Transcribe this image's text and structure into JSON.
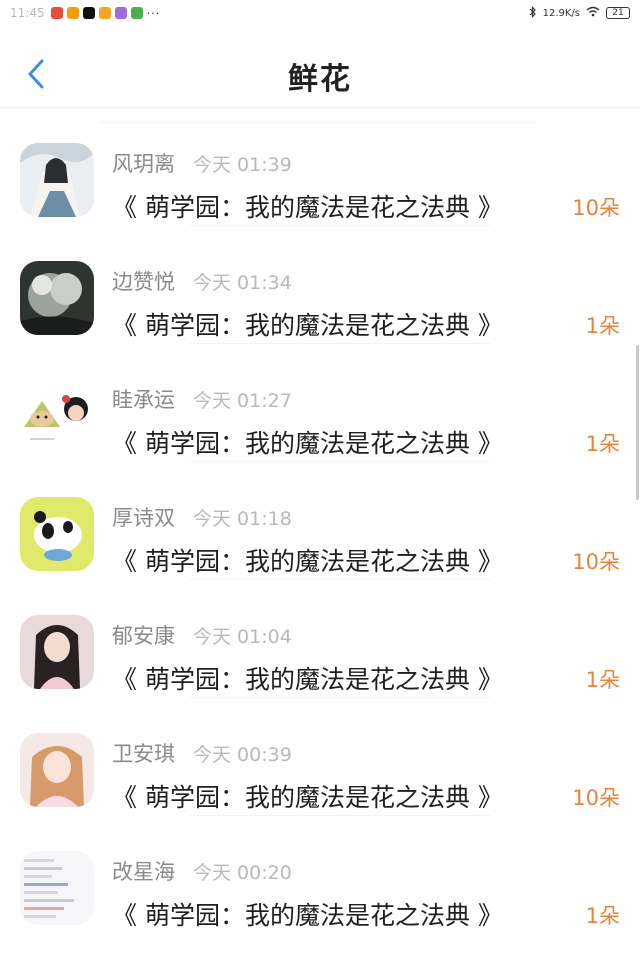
{
  "status_bar": {
    "time": "11:45",
    "icons": [
      "app-red-icon",
      "app-orange-icon",
      "tiktok-icon",
      "app-orange-icon",
      "app-purple-icon",
      "app-green-icon"
    ],
    "more": "···",
    "network_speed": "12.9K/s",
    "battery": "21"
  },
  "header": {
    "title": "鲜花",
    "back_icon": "chevron-left-icon",
    "accent": "#3a8ee6"
  },
  "colors": {
    "amount": "#e8833a",
    "name": "#8a8a8a",
    "time": "#b9b9b9"
  },
  "gifts": [
    {
      "name": "风玥离",
      "time": "今天 01:39",
      "book": "《 萌学园：我的魔法是花之法典 》",
      "amount": "10朵"
    },
    {
      "name": "边赞悦",
      "time": "今天 01:34",
      "book": "《 萌学园：我的魔法是花之法典 》",
      "amount": "1朵"
    },
    {
      "name": "眭承运",
      "time": "今天 01:27",
      "book": "《 萌学园：我的魔法是花之法典 》",
      "amount": "1朵"
    },
    {
      "name": "厚诗双",
      "time": "今天 01:18",
      "book": "《 萌学园：我的魔法是花之法典 》",
      "amount": "10朵"
    },
    {
      "name": "郁安康",
      "time": "今天 01:04",
      "book": "《 萌学园：我的魔法是花之法典 》",
      "amount": "1朵"
    },
    {
      "name": "卫安琪",
      "time": "今天 00:39",
      "book": "《 萌学园：我的魔法是花之法典 》",
      "amount": "10朵"
    },
    {
      "name": "改星海",
      "time": "今天 00:20",
      "book": "《 萌学园：我的魔法是花之法典 》",
      "amount": "1朵"
    }
  ]
}
